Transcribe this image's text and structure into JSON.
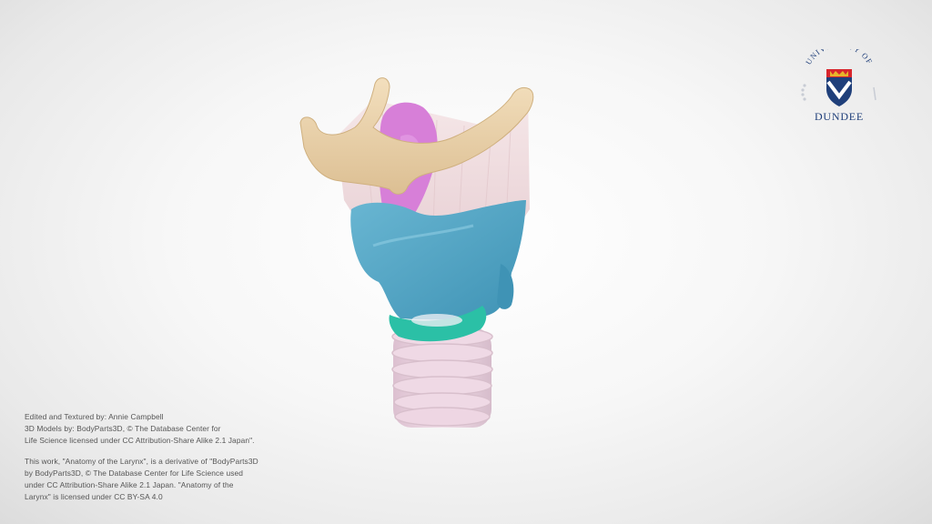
{
  "logo": {
    "arc_text": "UNIVERSITY OF",
    "name": "DUNDEE",
    "colors": {
      "navy": "#1f3f7a",
      "red": "#d8262d",
      "gold": "#e8b52a"
    }
  },
  "credits": {
    "block1": [
      "Edited and Textured by: Annie Campbell",
      "3D Models by: BodyParts3D, © The Database Center for",
      "Life Science licensed under CC Attribution-Share Alike 2.1 Japan\"."
    ],
    "block2": [
      "This work, \"Anatomy of the Larynx\", is a derivative of \"BodyParts3D",
      "by BodyParts3D, © The Database Center for Life Science used",
      "under CC Attribution-Share Alike 2.1 Japan. \"Anatomy of the",
      "Larynx\" is licensed under CC BY-SA 4.0"
    ]
  },
  "model": {
    "parts": {
      "hyoid": "#ecd3ab",
      "membrane": "#f1dfe0",
      "epiglottis": "#d77fd8",
      "thyroid_cartilage": "#5aaac8",
      "cricoid_cartilage": "#2bc0a6",
      "trachea": "#ead0dd"
    }
  }
}
